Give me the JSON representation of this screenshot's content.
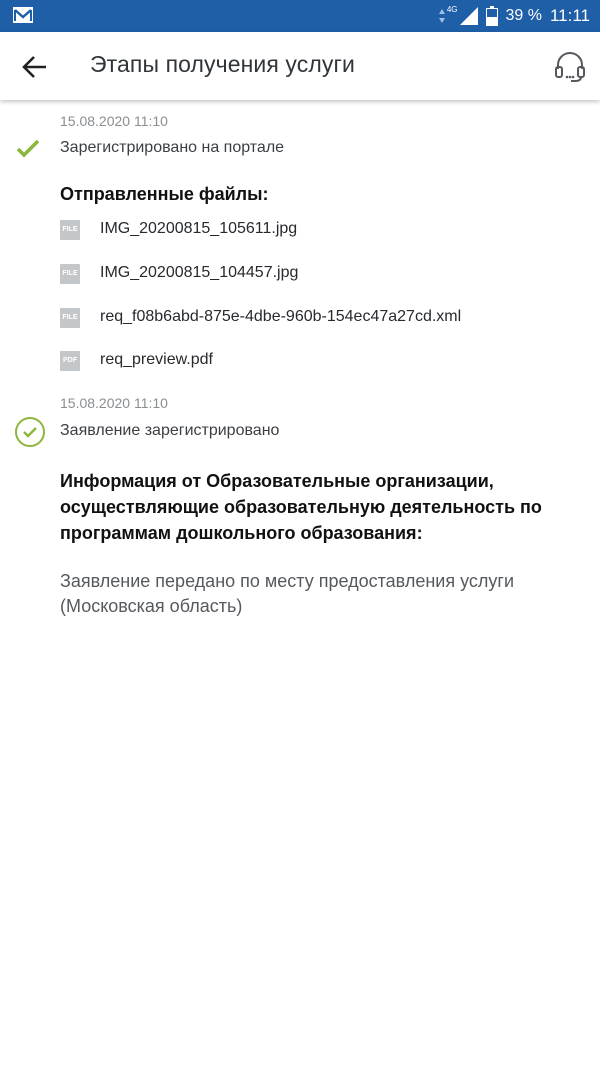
{
  "status_bar": {
    "network": "4G",
    "battery": "39 %",
    "time": "11:11",
    "notification_icon": "gmail-icon"
  },
  "header": {
    "title": "Этапы получения услуги",
    "back_icon": "arrow-left-icon",
    "support_icon": "headset-icon"
  },
  "timeline": [
    {
      "date": "15.08.2020 11:10",
      "label": "Зарегистрировано на портале",
      "status_icon": "checkmark-icon",
      "accent": "#8cb63c"
    },
    {
      "date": "15.08.2020 11:10",
      "label": "Заявление зарегистрировано",
      "status_icon": "check-circle-icon",
      "accent": "#8cb63c"
    }
  ],
  "files": {
    "title": "Отправленные файлы:",
    "items": [
      {
        "type": "FILE",
        "name": "IMG_20200815_105611.jpg"
      },
      {
        "type": "FILE",
        "name": "IMG_20200815_104457.jpg"
      },
      {
        "type": "FILE",
        "name": "req_f08b6abd-875e-4dbe-960b-154ec47a27cd.xml"
      },
      {
        "type": "PDF",
        "name": "req_preview.pdf"
      }
    ]
  },
  "info": {
    "title": "Информация от Образовательные организации, осуществляющие образовательную деятельность по программам дошкольного образования:",
    "text": "Заявление передано по месту предоставления услуги (Московская область)"
  }
}
